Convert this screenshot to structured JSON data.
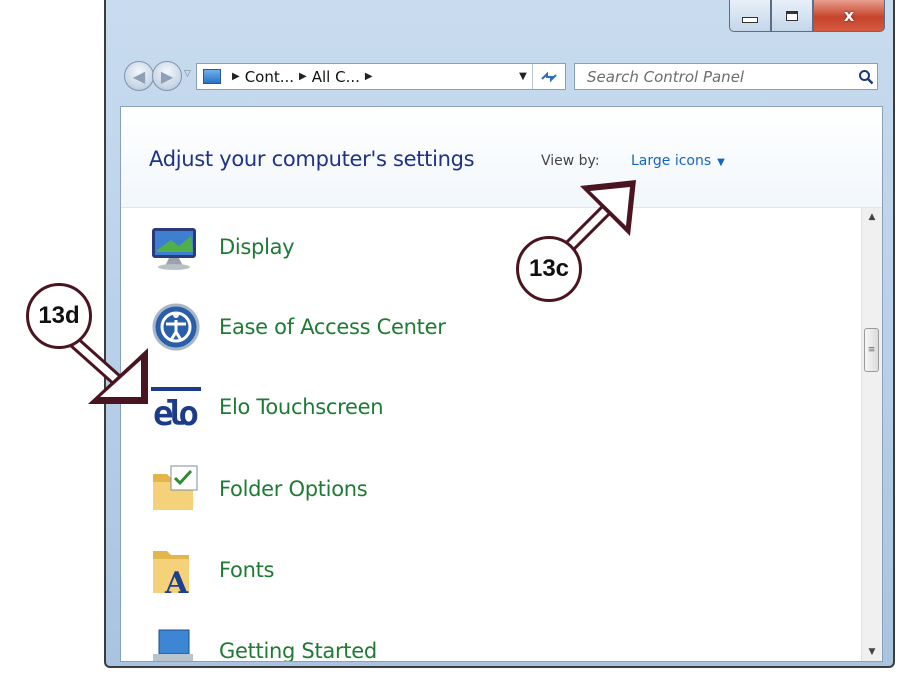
{
  "window": {
    "caption_buttons": [
      "minimize",
      "maximize",
      "close"
    ],
    "close_glyph": "x"
  },
  "navigation": {
    "back_icon": "back-arrow-icon",
    "forward_icon": "forward-arrow-icon",
    "breadcrumbs": [
      "Cont...",
      "All C..."
    ],
    "search_placeholder": "Search Control Panel"
  },
  "header": {
    "title": "Adjust your computer's settings",
    "view_by_label": "View by:",
    "view_by_value": "Large icons"
  },
  "items": [
    {
      "label": "Display",
      "icon": "display-icon"
    },
    {
      "label": "Ease of Access Center",
      "icon": "ease-of-access-icon"
    },
    {
      "label": "Elo Touchscreen",
      "icon": "elo-logo-icon"
    },
    {
      "label": "Folder Options",
      "icon": "folder-options-icon"
    },
    {
      "label": "Fonts",
      "icon": "fonts-folder-icon"
    },
    {
      "label": "Getting Started",
      "icon": "getting-started-icon"
    }
  ],
  "callouts": {
    "c13c": "13c",
    "c13d": "13d"
  },
  "colors": {
    "link_green": "#1f7a34",
    "heading_blue": "#1e3287",
    "callout_border": "#4a1420"
  }
}
